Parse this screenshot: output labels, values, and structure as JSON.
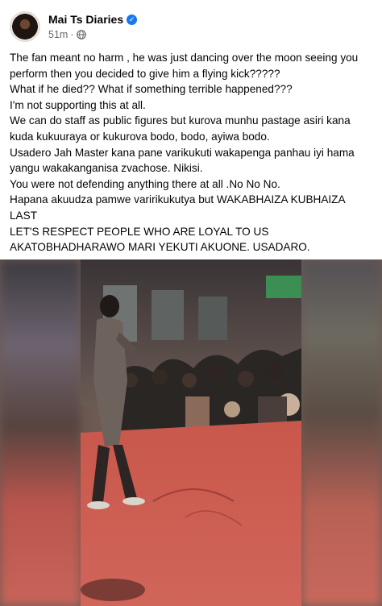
{
  "post": {
    "author": "Mai Ts Diaries",
    "timestamp": "51m",
    "separator": "·",
    "paragraphs": [
      "The fan meant no harm , he was just dancing over the moon seeing you perform then you decided to give him a flying kick?????",
      "What if he died?? What if something terrible happened???",
      "I'm not supporting this at all.",
      "We can do staff as public figures but kurova munhu pastage asiri kana kuda kukuuraya or kukurova bodo, bodo, ayiwa bodo.",
      "Usadero Jah Master kana pane varikukuti wakapenga panhau iyi hama yangu wakakanganisa zvachose. Nikisi.",
      "You were not defending anything there at all .No No No.",
      "Hapana akuudza pamwe varirikukutya but WAKABHAIZA KUBHAIZA LAST",
      "LET'S RESPECT PEOPLE WHO ARE LOYAL TO US AKATOBHADHARAWO MARI YEKUTI AKUONE. USADARO."
    ]
  },
  "icons": {
    "verified": "verified-badge-icon",
    "audience": "globe-icon",
    "avatar": "profile-avatar"
  },
  "colors": {
    "accent": "#1877f2",
    "secondary_text": "#65676b",
    "stage_floor": "#c8584d"
  }
}
